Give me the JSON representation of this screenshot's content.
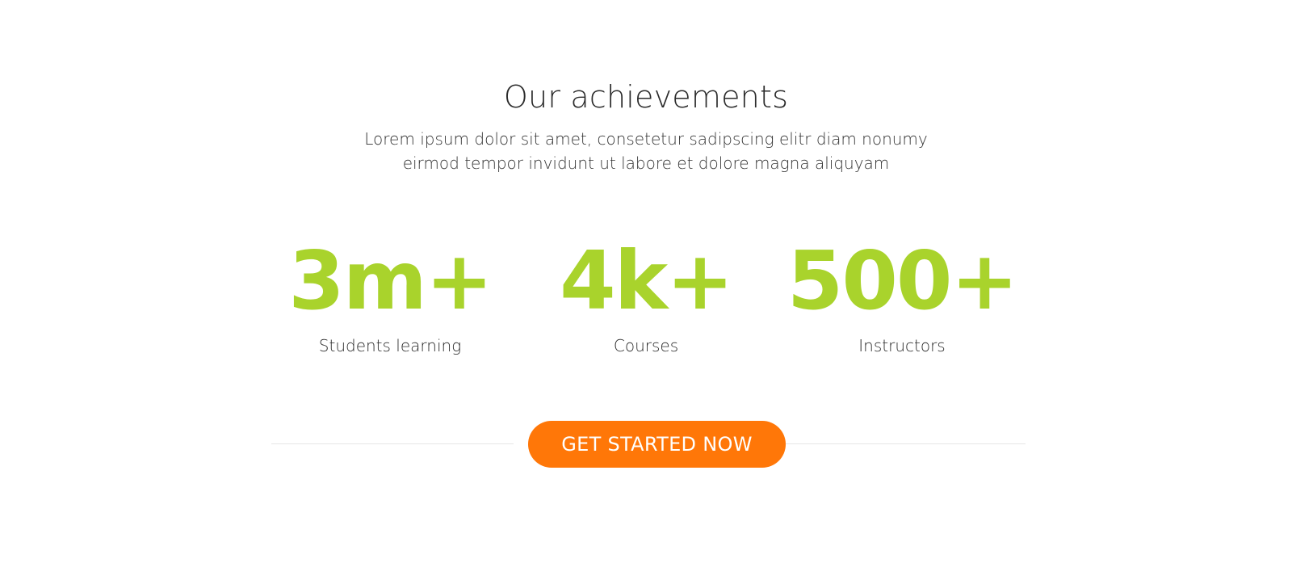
{
  "section": {
    "title": "Our achievements",
    "subtitle": "Lorem ipsum dolor sit amet, consetetur sadipscing elitr diam nonumy eirmod tempor invidunt ut labore et dolore magna aliquyam"
  },
  "stats": [
    {
      "value": "3m+",
      "label": "Students learning"
    },
    {
      "value": "4k+",
      "label": "Courses"
    },
    {
      "value": "500+",
      "label": "Instructors"
    }
  ],
  "cta": {
    "label": "GET STARTED NOW"
  },
  "colors": {
    "accent_green": "#a9d32c",
    "cta_orange": "#ff7708",
    "text": "#2b2b2b",
    "divider": "#e6e6e6"
  }
}
